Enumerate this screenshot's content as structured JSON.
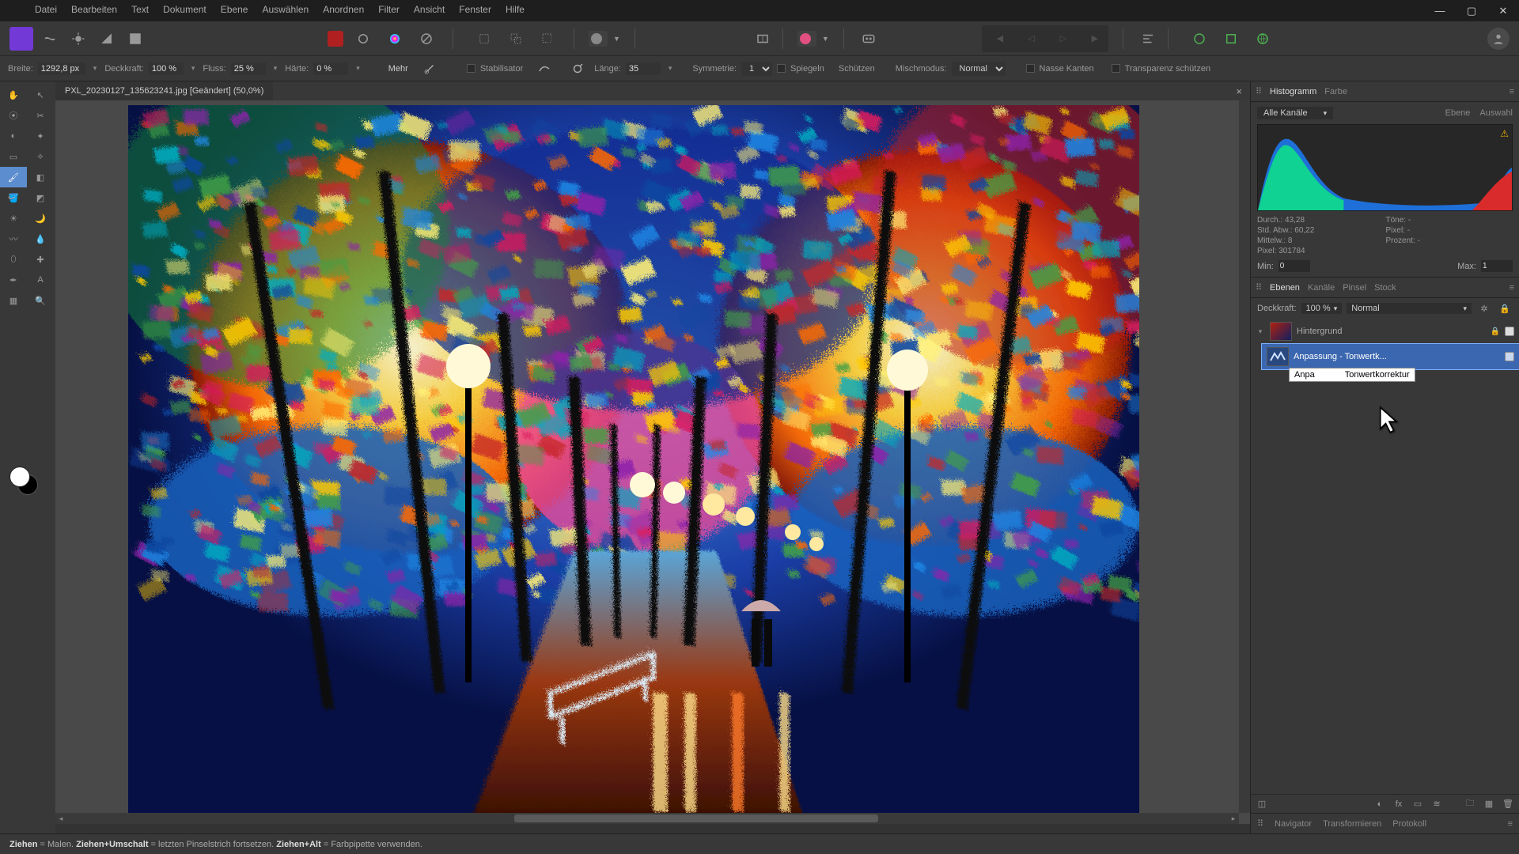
{
  "menu": [
    "Datei",
    "Bearbeiten",
    "Text",
    "Dokument",
    "Ebene",
    "Auswählen",
    "Anordnen",
    "Filter",
    "Ansicht",
    "Fenster",
    "Hilfe"
  ],
  "doc": {
    "tab_label": "PXL_20230127_135623241.jpg [Geändert] (50,0%)"
  },
  "ctx": {
    "breite_label": "Breite:",
    "breite": "1292,8 px",
    "deck_label": "Deckkraft:",
    "deck": "100 %",
    "fluss_label": "Fluss:",
    "fluss": "25 %",
    "haerte_label": "Härte:",
    "haerte": "0 %",
    "mehr": "Mehr",
    "stabil": "Stabilisator",
    "laenge_label": "Länge:",
    "laenge": "35",
    "sym_label": "Symmetrie:",
    "sym_val": "1",
    "spiegeln": "Spiegeln",
    "schuetzen": "Schützen",
    "misch_label": "Mischmodus:",
    "misch_val": "Normal",
    "nasse": "Nasse Kanten",
    "transp": "Transparenz schützen"
  },
  "hist": {
    "tab1": "Histogramm",
    "tab2": "Farbe",
    "channels": "Alle Kanäle",
    "seg_ebene": "Ebene",
    "seg_auswahl": "Auswahl",
    "st_durch": "Durch.: 43,28",
    "st_std": "Std. Abw.: 60,22",
    "st_mittel": "Mittelw.: 8",
    "st_pixel": "Pixel: 301784",
    "st_toene": "Töne: -",
    "st_pixel2": "Pixel: -",
    "st_prozent": "Prozent: -",
    "min_label": "Min:",
    "min": "0",
    "max_label": "Max:",
    "max": "1"
  },
  "layers": {
    "tab1": "Ebenen",
    "tab2": "Kanäle",
    "tab3": "Pinsel",
    "tab4": "Stock",
    "deck_label": "Deckkraft:",
    "deck": "100 %",
    "blend": "Normal",
    "row_bg": "Hintergrund",
    "row_adj": "Anpassung - Tonwertk...",
    "tooltip_left": "Anpa",
    "tooltip_right": "Tonwertkorrektur"
  },
  "nav": {
    "t1": "Navigator",
    "t2": "Transformieren",
    "t3": "Protokoll"
  },
  "status": {
    "s1": "Ziehen",
    "e1": "Malen.",
    "s2": "Ziehen+Umschalt",
    "e2": "letzten Pinselstrich fortsetzen.",
    "s3": "Ziehen+Alt",
    "e3": "Farbpipette verwenden."
  }
}
